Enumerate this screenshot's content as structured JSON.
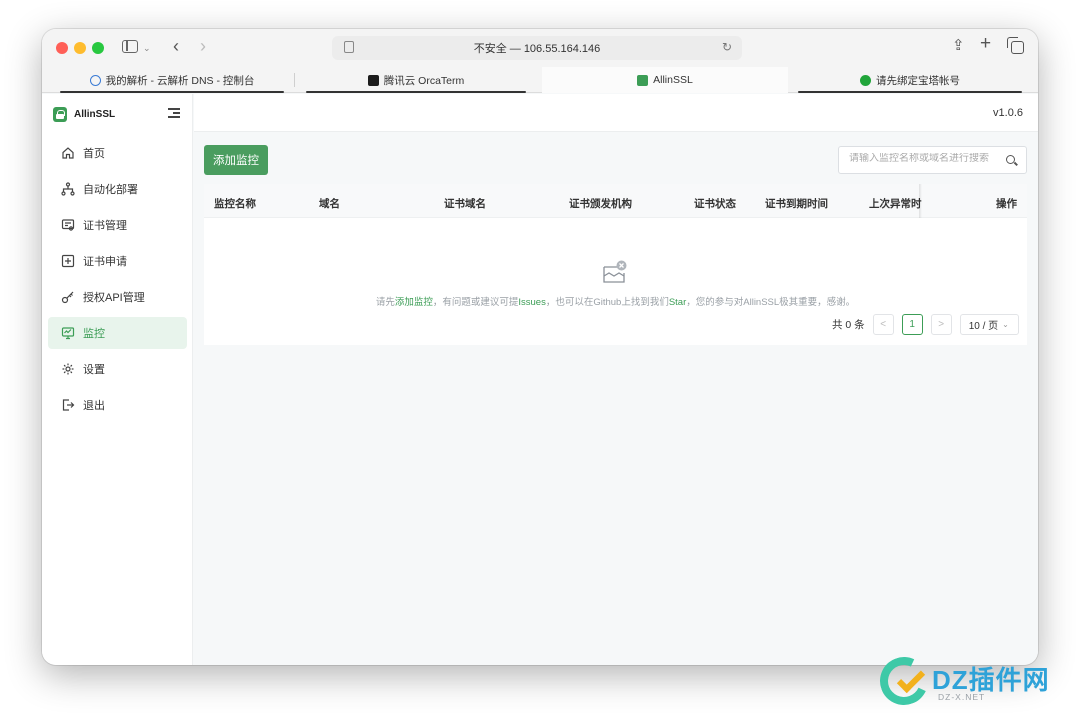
{
  "browser": {
    "address": "不安全 — 106.55.164.146",
    "tabs": [
      {
        "label": "我的解析 - 云解析 DNS - 控制台",
        "icon": "cloud-icon"
      },
      {
        "label": "腾讯云 OrcaTerm",
        "icon": "terminal-icon"
      },
      {
        "label": "AllinSSL",
        "icon": "lock-icon"
      },
      {
        "label": "请先绑定宝塔帐号",
        "icon": "bt-icon"
      }
    ]
  },
  "app": {
    "brand": "AllinSSL",
    "version": "v1.0.6",
    "accent_color": "#3c9d56"
  },
  "sidebar": {
    "items": [
      {
        "label": "首页",
        "icon": "home-icon"
      },
      {
        "label": "自动化部署",
        "icon": "workflow-icon"
      },
      {
        "label": "证书管理",
        "icon": "certificate-icon"
      },
      {
        "label": "证书申请",
        "icon": "plus-square-icon"
      },
      {
        "label": "授权API管理",
        "icon": "key-icon"
      },
      {
        "label": "监控",
        "icon": "monitor-icon",
        "active": true
      },
      {
        "label": "设置",
        "icon": "gear-icon"
      },
      {
        "label": "退出",
        "icon": "logout-icon"
      }
    ]
  },
  "toolbar": {
    "add_label": "添加监控",
    "search_placeholder": "请输入监控名称或域名进行搜索"
  },
  "table": {
    "columns": [
      "监控名称",
      "域名",
      "证书域名",
      "证书颁发机构",
      "证书状态",
      "证书到期时间",
      "上次异常时",
      "操作"
    ],
    "empty": {
      "prefix": "请先",
      "add_link": "添加监控",
      "middle": "，有问题或建议可提",
      "issues_link": "Issues",
      "middle2": "，也可以在Github上找到我们",
      "star_link": "Star",
      "suffix": "，您的参与对AllinSSL极其重要，感谢。"
    }
  },
  "pagination": {
    "total": "共 0 条",
    "prev": "<",
    "page": "1",
    "next": ">",
    "page_size": "10 / 页"
  },
  "watermark": {
    "text": "DZ插件网",
    "sub": "DZ-X.NET"
  }
}
